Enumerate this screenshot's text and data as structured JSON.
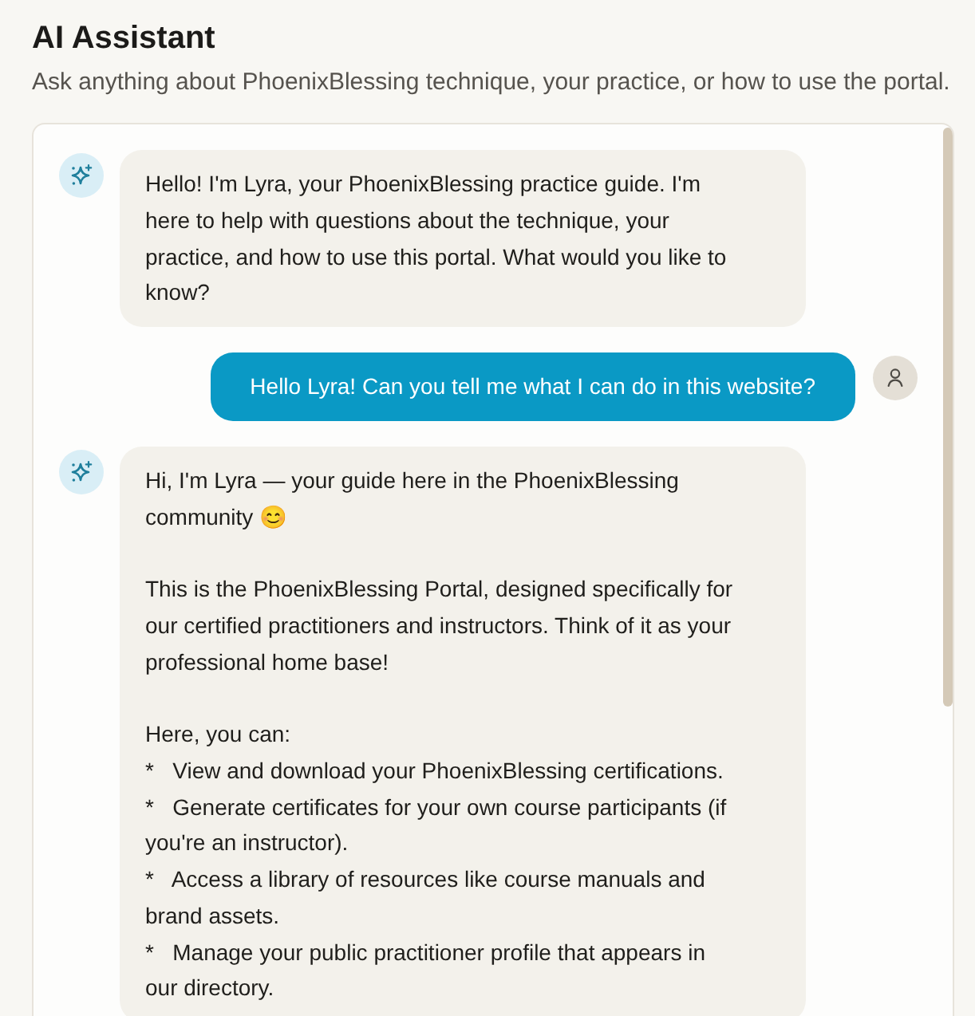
{
  "header": {
    "title": "AI Assistant",
    "subtitle": "Ask anything about PhoenixBlessing technique, your practice, or how to use the portal."
  },
  "messages": [
    {
      "kind": "assistant",
      "blocks": [
        [
          "Hello! I'm Lyra, your PhoenixBlessing practice guide. I'm here to help with questions about the technique, your practice, and how to use this portal. What would you like to know?"
        ]
      ]
    },
    {
      "kind": "user",
      "text": "Hello Lyra! Can you tell me what I can do in this website?"
    },
    {
      "kind": "assistant",
      "blocks": [
        [
          "Hi, I'm Lyra — your guide here in the PhoenixBlessing community 😊"
        ],
        [
          "This is the PhoenixBlessing Portal, designed specifically for our certified practitioners and instructors. Think of it as your professional home base!"
        ],
        [
          "Here, you can:",
          "*   View and download your PhoenixBlessing certifications.",
          "*   Generate certificates for your own course participants (if you're an instructor).",
          "*   Access a library of resources like course manuals and brand assets.",
          "*   Manage your public practitioner profile that appears in our directory."
        ]
      ]
    }
  ]
}
